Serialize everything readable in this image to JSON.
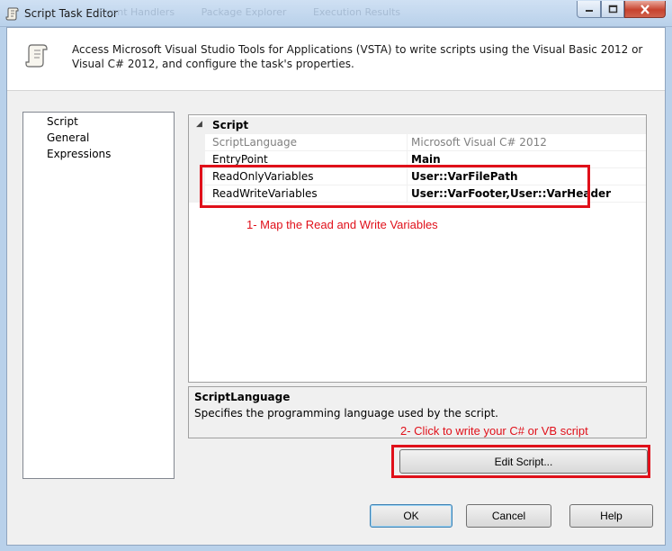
{
  "window": {
    "title": "Script Task Editor",
    "background_tabs": [
      "Event Handlers",
      "Package Explorer",
      "Execution Results"
    ],
    "title_icon": "script-icon"
  },
  "header": {
    "description": "Access Microsoft Visual Studio Tools for Applications (VSTA) to write scripts using the Visual Basic 2012 or Visual C# 2012, and configure the task's properties.",
    "icon": "script-scroll-icon"
  },
  "nav": {
    "items": [
      {
        "label": "Script"
      },
      {
        "label": "General"
      },
      {
        "label": "Expressions"
      }
    ]
  },
  "grid": {
    "category": "Script",
    "rows": [
      {
        "name": "ScriptLanguage",
        "value": "Microsoft Visual C# 2012"
      },
      {
        "name": "EntryPoint",
        "value": "Main"
      },
      {
        "name": "ReadOnlyVariables",
        "value": "User::VarFilePath"
      },
      {
        "name": "ReadWriteVariables",
        "value": "User::VarFooter,User::VarHeader"
      }
    ]
  },
  "description_panel": {
    "title": "ScriptLanguage",
    "text": "Specifies the programming language used by the script."
  },
  "annotations": {
    "note1": "1- Map the Read and Write Variables",
    "note2": "2- Click to write your C# or VB script",
    "color": "#e0101a"
  },
  "buttons": {
    "edit_script": "Edit Script...",
    "ok": "OK",
    "cancel": "Cancel",
    "help": "Help"
  },
  "colors": {
    "frame": "#b9d1ea",
    "client": "#f0f0f0",
    "close_button": "#c7432e"
  }
}
